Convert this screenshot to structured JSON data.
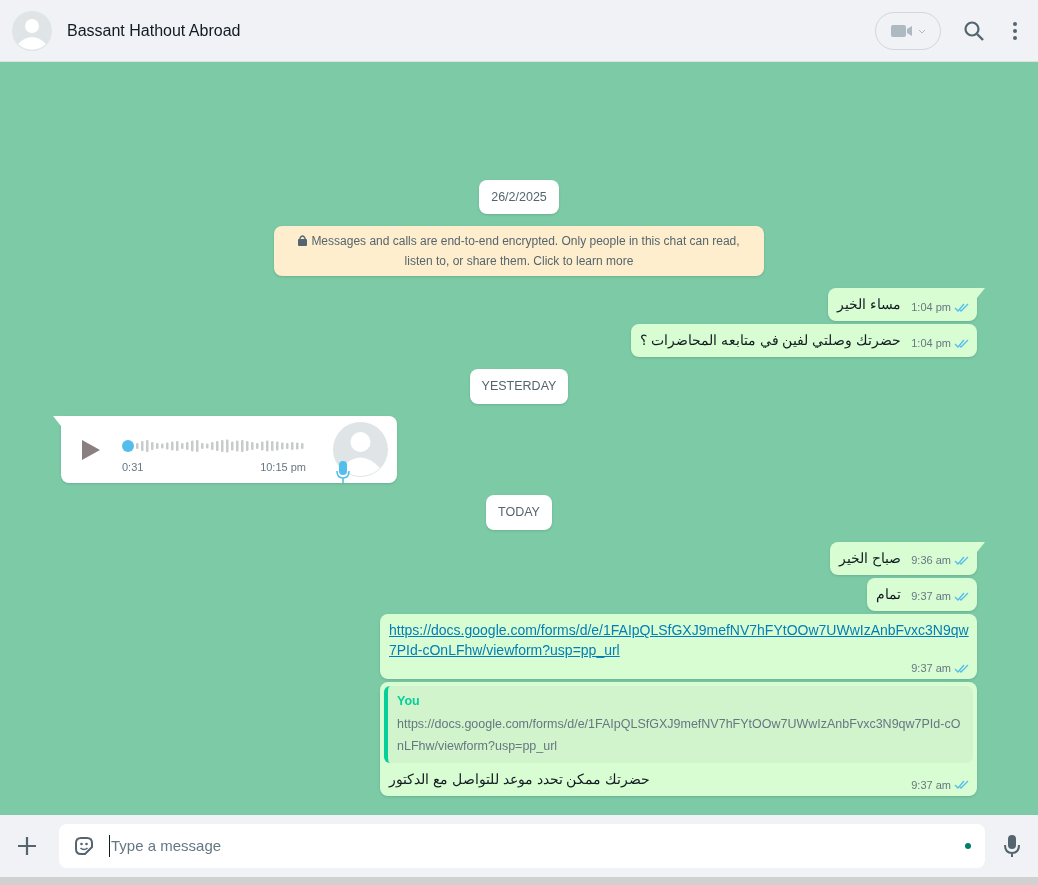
{
  "header": {
    "contact_name": "Bassant Hathout Abroad"
  },
  "messages": [
    {
      "kind": "date",
      "text": "26/2/2025"
    },
    {
      "kind": "system",
      "text": "Messages and calls are end-to-end encrypted. Only people in this chat can read, listen to, or share them. Click to learn more"
    },
    {
      "kind": "text",
      "outgoing": true,
      "tail": true,
      "text": "مساء الخير",
      "time": "1:04 pm",
      "read": true
    },
    {
      "kind": "text",
      "outgoing": true,
      "tail": false,
      "text": "حضرتك وصلتي لفين في متابعه المحاضرات ؟",
      "time": "1:04 pm",
      "read": true
    },
    {
      "kind": "date",
      "text": "YESTERDAY"
    },
    {
      "kind": "voice",
      "outgoing": false,
      "tail": true,
      "duration": "0:31",
      "time": "10:15 pm"
    },
    {
      "kind": "date",
      "text": "TODAY"
    },
    {
      "kind": "text",
      "outgoing": true,
      "tail": true,
      "text": "صباح الخير",
      "time": "9:36 am",
      "read": true
    },
    {
      "kind": "text",
      "outgoing": true,
      "tail": false,
      "text": "تمام",
      "time": "9:37 am",
      "read": true
    },
    {
      "kind": "link",
      "outgoing": true,
      "tail": false,
      "text": "https://docs.google.com/forms/d/e/1FAIpQLSfGXJ9mefNV7hFYtOOw7UWwIzAnbFvxc3N9qw7PId-cOnLFhw/viewform?usp=pp_url",
      "time": "9:37 am",
      "read": true
    },
    {
      "kind": "reply",
      "outgoing": true,
      "tail": false,
      "quote_author": "You",
      "quote_text": "https://docs.google.com/forms/d/e/1FAIpQLSfGXJ9mefNV7hFYtOOw7UWwIzAnbFvxc3N9qw7PId-cOnLFhw/viewform?usp=pp_url",
      "text": "حضرتك ممكن تحدد موعد للتواصل مع الدكتور",
      "time": "9:37 am",
      "read": true
    }
  ],
  "composer": {
    "placeholder": "Type a message"
  }
}
